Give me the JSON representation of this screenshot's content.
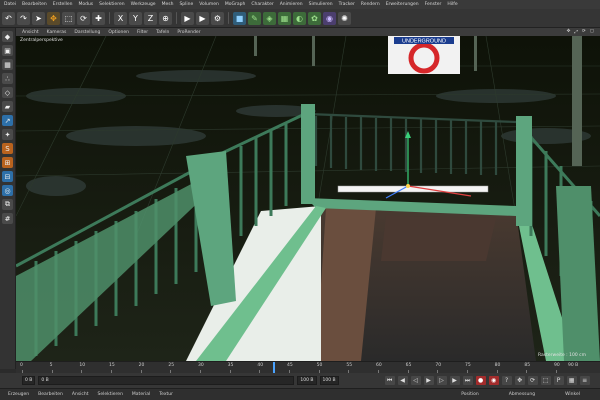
{
  "menu": [
    "Datei",
    "Bearbeiten",
    "Erstellen",
    "Modus",
    "Selektieren",
    "Werkzeuge",
    "Mesh",
    "Spline",
    "Volumen",
    "MoGraph",
    "Charakter",
    "Animieren",
    "Simulieren",
    "Tracker",
    "Rendern",
    "Erweiterungen",
    "Fenster",
    "Hilfe"
  ],
  "viewport": {
    "menu": [
      "Ansicht",
      "Kameras",
      "Darstellung",
      "Optionen",
      "Filter",
      "Tafeln",
      "ProRender"
    ],
    "label": "Zentralperspektive",
    "distance": "Rasterweite : 100 cm",
    "sign_text": "UNDERGROUND"
  },
  "timeline": {
    "ticks": [
      "0",
      "5",
      "10",
      "15",
      "20",
      "25",
      "30",
      "35",
      "40",
      "45",
      "50",
      "55",
      "60",
      "65",
      "70",
      "75",
      "80",
      "85",
      "90"
    ],
    "frame_end": "90 B",
    "playhead_fraction": 0.47
  },
  "transport": {
    "start": "0 B",
    "current": "0 B",
    "end": "100 B",
    "end2": "100 B"
  },
  "bottom": {
    "menu": [
      "Erzeugen",
      "Bearbeiten",
      "Ansicht",
      "Selektieren",
      "Material",
      "Textur"
    ],
    "coords": [
      "Position",
      "Abmessung",
      "Winkel"
    ]
  },
  "colors": {
    "railing": "#6fbf8e",
    "sign_red": "#d6272a",
    "sign_blue": "#1b3d8f",
    "playhead": "#4aa3ff"
  }
}
